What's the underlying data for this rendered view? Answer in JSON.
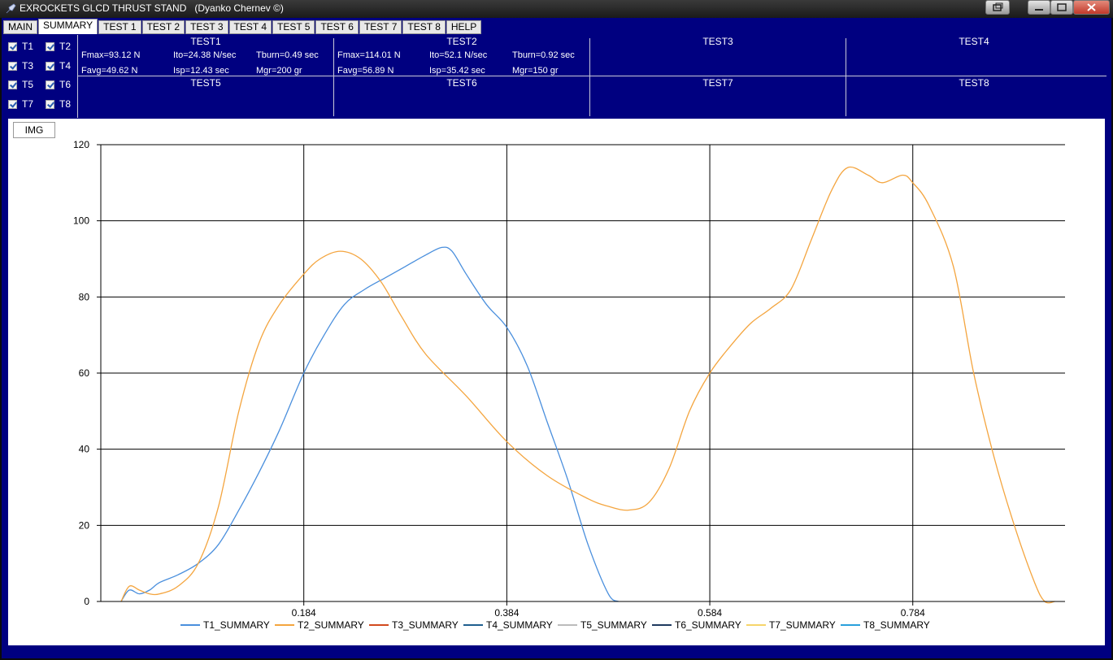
{
  "window": {
    "title": "EXROCKETS GLCD THRUST STAND   (Dyanko Chernev ©)"
  },
  "tabs": [
    "MAIN",
    "SUMMARY",
    "TEST 1",
    "TEST 2",
    "TEST 3",
    "TEST 4",
    "TEST 5",
    "TEST 6",
    "TEST 7",
    "TEST 8",
    "HELP"
  ],
  "active_tab": "SUMMARY",
  "checkboxes": [
    {
      "label": "T1",
      "checked": true
    },
    {
      "label": "T2",
      "checked": true
    },
    {
      "label": "T3",
      "checked": true
    },
    {
      "label": "T4",
      "checked": true
    },
    {
      "label": "T5",
      "checked": true
    },
    {
      "label": "T6",
      "checked": true
    },
    {
      "label": "T7",
      "checked": true
    },
    {
      "label": "T8",
      "checked": true
    }
  ],
  "tests": [
    {
      "name": "TEST1",
      "fmax": "Fmax=93.12 N",
      "ito": "Ito=24.38 N/sec",
      "tburn": "Tburn=0.49 sec",
      "favg": "Favg=49.62 N",
      "isp": "Isp=12.43 sec",
      "mgr": "Mgr=200 gr"
    },
    {
      "name": "TEST2",
      "fmax": "Fmax=114.01 N",
      "ito": "Ito=52.1 N/sec",
      "tburn": "Tburn=0.92 sec",
      "favg": "Favg=56.89 N",
      "isp": "Isp=35.42 sec",
      "mgr": "Mgr=150 gr"
    },
    {
      "name": "TEST3"
    },
    {
      "name": "TEST4"
    },
    {
      "name": "TEST5"
    },
    {
      "name": "TEST6"
    },
    {
      "name": "TEST7"
    },
    {
      "name": "TEST8"
    }
  ],
  "img_button": "IMG",
  "chart_data": {
    "type": "line",
    "xlim": [
      -0.016,
      0.934
    ],
    "ylim": [
      0,
      120
    ],
    "grid": true,
    "legend_position": "bottom",
    "x_ticks": [
      0.184,
      0.384,
      0.584,
      0.784
    ],
    "y_ticks": [
      0,
      20,
      40,
      60,
      80,
      100,
      120
    ],
    "series": [
      {
        "name": "T1_SUMMARY",
        "color": "#4a8fdd",
        "x": [
          0.004,
          0.012,
          0.022,
          0.032,
          0.042,
          0.06,
          0.08,
          0.1,
          0.12,
          0.14,
          0.16,
          0.184,
          0.204,
          0.224,
          0.244,
          0.264,
          0.284,
          0.304,
          0.32,
          0.33,
          0.344,
          0.364,
          0.384,
          0.404,
          0.424,
          0.444,
          0.464,
          0.484,
          0.494
        ],
        "y": [
          0,
          3,
          2,
          3,
          5,
          7,
          10,
          15,
          24,
          34,
          45,
          60,
          70,
          78,
          82,
          85,
          88,
          91,
          93,
          92,
          86,
          78,
          72,
          62,
          47,
          32,
          15,
          2,
          0
        ]
      },
      {
        "name": "T2_SUMMARY",
        "color": "#f4a53f",
        "x": [
          0.004,
          0.012,
          0.022,
          0.032,
          0.042,
          0.06,
          0.08,
          0.1,
          0.12,
          0.14,
          0.16,
          0.184,
          0.2,
          0.22,
          0.24,
          0.26,
          0.28,
          0.304,
          0.344,
          0.384,
          0.424,
          0.464,
          0.484,
          0.504,
          0.524,
          0.544,
          0.564,
          0.584,
          0.604,
          0.624,
          0.644,
          0.664,
          0.684,
          0.704,
          0.72,
          0.74,
          0.754,
          0.774,
          0.784,
          0.8,
          0.824,
          0.844,
          0.864,
          0.884,
          0.904,
          0.914,
          0.924
        ],
        "y": [
          0,
          4,
          3,
          2,
          2,
          4,
          10,
          25,
          50,
          68,
          78,
          86,
          90,
          92,
          90,
          84,
          75,
          65,
          54,
          42,
          33,
          27,
          25,
          24,
          26,
          35,
          50,
          60,
          67,
          73,
          77,
          82,
          95,
          108,
          114,
          112,
          110,
          112,
          110,
          104,
          88,
          60,
          38,
          20,
          5,
          0,
          0
        ]
      },
      {
        "name": "T3_SUMMARY",
        "color": "#d24a1e",
        "x": [],
        "y": []
      },
      {
        "name": "T4_SUMMARY",
        "color": "#1f5f8f",
        "x": [],
        "y": []
      },
      {
        "name": "T5_SUMMARY",
        "color": "#bbbbbb",
        "x": [],
        "y": []
      },
      {
        "name": "T6_SUMMARY",
        "color": "#1e3a5f",
        "x": [],
        "y": []
      },
      {
        "name": "T7_SUMMARY",
        "color": "#f6d56a",
        "x": [],
        "y": []
      },
      {
        "name": "T8_SUMMARY",
        "color": "#2aa0dc",
        "x": [],
        "y": []
      }
    ]
  }
}
